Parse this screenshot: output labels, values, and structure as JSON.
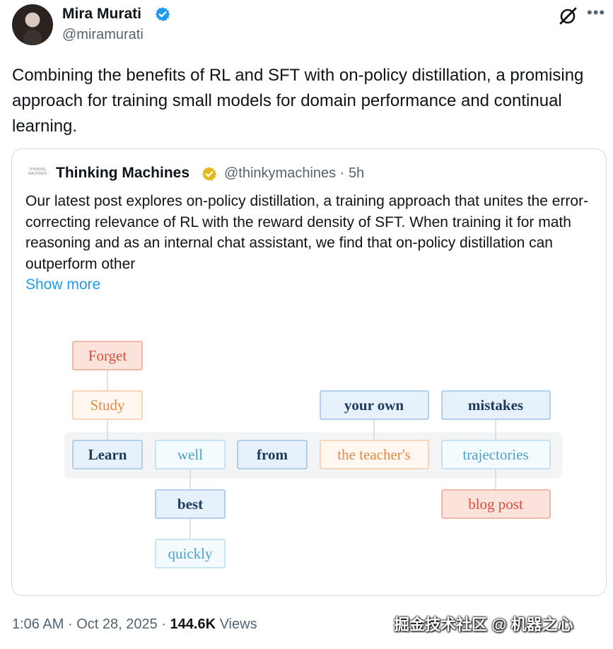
{
  "author": {
    "name": "Mira Murati",
    "handle": "@miramurati"
  },
  "tweet": {
    "text": "Combining the benefits of RL and SFT with on-policy distillation, a promising approach for training small models for domain performance and continual learning."
  },
  "quote": {
    "logo_text": "THINKING MACHINES",
    "name": "Thinking Machines",
    "handle": "@thinkymachines",
    "separator": "·",
    "time": "5h",
    "text": "Our latest post explores on-policy distillation, a training approach that unites the error-correcting relevance of RL with the reward density of SFT. When training it for math reasoning and as an internal chat assistant, we find that on-policy distillation can outperform other",
    "show_more": "Show more",
    "diagram_words": {
      "forget": "Forget",
      "study": "Study",
      "learn": "Learn",
      "well": "well",
      "best": "best",
      "quickly": "quickly",
      "from": "from",
      "your_own": "your own",
      "the_teachers": "the teacher's",
      "mistakes": "mistakes",
      "trajectories": "trajectories",
      "blog_post": "blog post"
    },
    "colors": {
      "red_border": "#f0a595",
      "red_fill": "#fbe3dc",
      "red_text": "#d8503a",
      "orange_border": "#f6c9a6",
      "orange_fill": "#fff7f0",
      "orange_text": "#e28a46",
      "blue_border": "#9ec4e8",
      "blue_fill": "#e6f1fb",
      "blue_text": "#1e3a5f",
      "lightblue_border": "#b6dcef",
      "lightblue_fill": "#f4fbfe",
      "lightblue_text": "#4aa0cf",
      "band": "#f3f4f5"
    }
  },
  "footer": {
    "time": "1:06 AM",
    "dot1": "·",
    "date": "Oct 28, 2025",
    "dot2": "·",
    "views_count": "144.6K",
    "views_label": "Views"
  },
  "watermark": "掘金技术社区 @ 机器之心"
}
